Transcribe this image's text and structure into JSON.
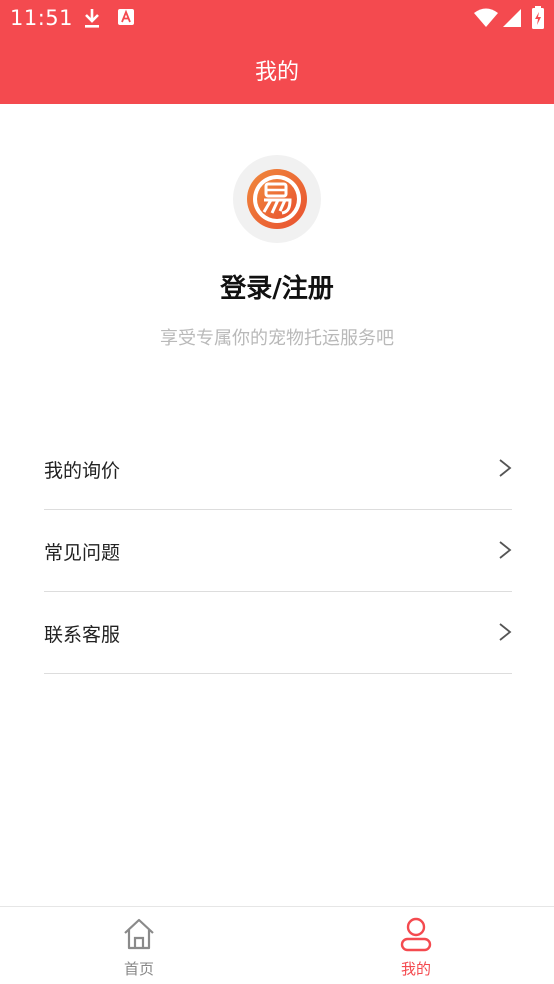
{
  "status_bar": {
    "time": "11:51",
    "icons": [
      "download-icon",
      "notification-a-icon",
      "wifi-icon",
      "signal-icon",
      "battery-icon"
    ]
  },
  "header": {
    "title": "我的",
    "background": "#f44a4f"
  },
  "profile": {
    "logo_icon": "brand-logo",
    "login_label": "登录/注册",
    "subtitle": "享受专属你的宠物托运服务吧"
  },
  "menu": {
    "items": [
      {
        "label": "我的询价",
        "icon": "chevron-right-icon"
      },
      {
        "label": "常见问题",
        "icon": "chevron-right-icon"
      },
      {
        "label": "联系客服",
        "icon": "chevron-right-icon"
      }
    ]
  },
  "tabbar": {
    "tabs": [
      {
        "label": "首页",
        "icon": "home-icon",
        "active": false,
        "color": "#888888"
      },
      {
        "label": "我的",
        "icon": "user-icon",
        "active": true,
        "color": "#f44a4f"
      }
    ]
  }
}
